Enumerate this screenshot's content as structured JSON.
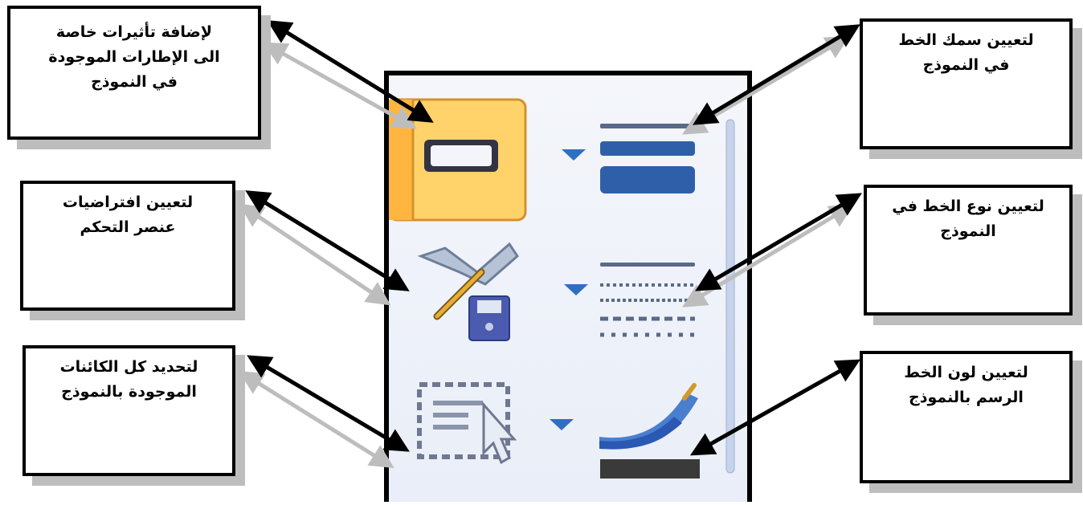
{
  "callouts": {
    "effects": {
      "line1": "لإضافة تأثيرات خاصة",
      "line2": "الى الإطارات الموجودة",
      "line3": "في النموذج"
    },
    "defaults": {
      "line1": "لتعيين افتراضيات",
      "line2": "عنصر التحكم"
    },
    "select": {
      "line1": "لتحديد كل الكائنات",
      "line2": "الموجودة بالنموذج"
    },
    "thickness": {
      "line1": "لتعيين سمك الخط",
      "line2": "في النموذج"
    },
    "type": {
      "line1": "لتعيين نوع الخط في",
      "line2": "النموذج"
    },
    "color": {
      "line1": "لتعيين لون الخط",
      "line2": "الرسم بالنموذج"
    }
  },
  "tools": [
    {
      "name": "shape-effects-button",
      "icon": "shape-effects-icon"
    },
    {
      "name": "set-control-defaults-button",
      "icon": "hammer-wrench-save-icon"
    },
    {
      "name": "select-all-button",
      "icon": "dashed-selection-cursor-icon"
    },
    {
      "name": "line-thickness-button",
      "icon": "line-thickness-icon"
    },
    {
      "name": "line-type-button",
      "icon": "line-type-icon"
    },
    {
      "name": "line-color-button",
      "icon": "paintbrush-line-color-icon"
    }
  ],
  "colors": {
    "accent": "#2f5fa8",
    "selected_fill": "#ffc24a",
    "border": "#000000",
    "shadow": "#bdbdbd"
  }
}
